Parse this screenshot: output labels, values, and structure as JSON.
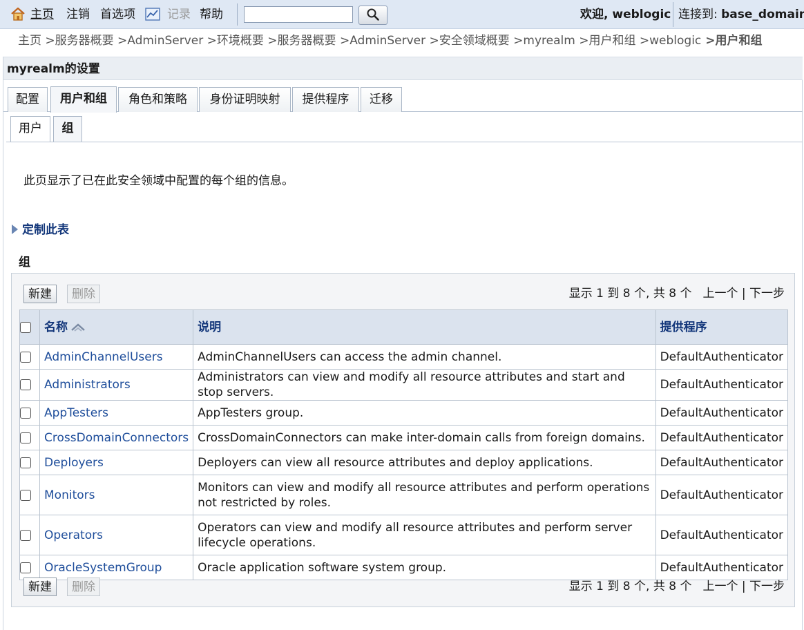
{
  "topbar": {
    "home": "主页",
    "logout": "注销",
    "preferences": "首选项",
    "record": "记录",
    "help": "帮助",
    "search_value": "",
    "welcome": "欢迎, weblogic",
    "connected_label": "连接到:",
    "domain": "base_domain"
  },
  "breadcrumb": [
    "主页",
    " >服务器概要",
    " >AdminServer",
    " >环境概要",
    " >服务器概要",
    " >AdminServer",
    " >安全领域概要",
    " >myrealm",
    " >用户和组",
    " >weblogic"
  ],
  "breadcrumb_current": " >用户和组",
  "panel_title": "myrealm的设置",
  "tabs": [
    "配置",
    "用户和组",
    "角色和策略",
    "身份证明映射",
    "提供程序",
    "迁移"
  ],
  "subtabs": [
    "用户",
    "组"
  ],
  "description": "此页显示了已在此安全领域中配置的每个组的信息。",
  "customize": "定制此表",
  "group_title": "组",
  "buttons": {
    "new": "新建",
    "delete": "删除"
  },
  "pager": {
    "range": "显示 1 到 8 个, 共 8 个",
    "prev": "上一个",
    "sep": "|",
    "next": "下一步"
  },
  "columns": {
    "name": "名称",
    "description": "说明",
    "provider": "提供程序"
  },
  "rows": [
    {
      "name": "AdminChannelUsers",
      "description": "AdminChannelUsers can access the admin channel.",
      "provider": "DefaultAuthenticator"
    },
    {
      "name": "Administrators",
      "description": "Administrators can view and modify all resource attributes and start and stop servers.",
      "provider": "DefaultAuthenticator"
    },
    {
      "name": "AppTesters",
      "description": "AppTesters group.",
      "provider": "DefaultAuthenticator"
    },
    {
      "name": "CrossDomainConnectors",
      "description": "CrossDomainConnectors can make inter-domain calls from foreign domains.",
      "provider": "DefaultAuthenticator"
    },
    {
      "name": "Deployers",
      "description": "Deployers can view all resource attributes and deploy applications.",
      "provider": "DefaultAuthenticator"
    },
    {
      "name": "Monitors",
      "description": "Monitors can view and modify all resource attributes and perform operations not restricted by roles.",
      "provider": "DefaultAuthenticator"
    },
    {
      "name": "Operators",
      "description": "Operators can view and modify all resource attributes and perform server lifecycle operations.",
      "provider": "DefaultAuthenticator"
    },
    {
      "name": "OracleSystemGroup",
      "description": "Oracle application software system group.",
      "provider": "DefaultAuthenticator"
    }
  ]
}
